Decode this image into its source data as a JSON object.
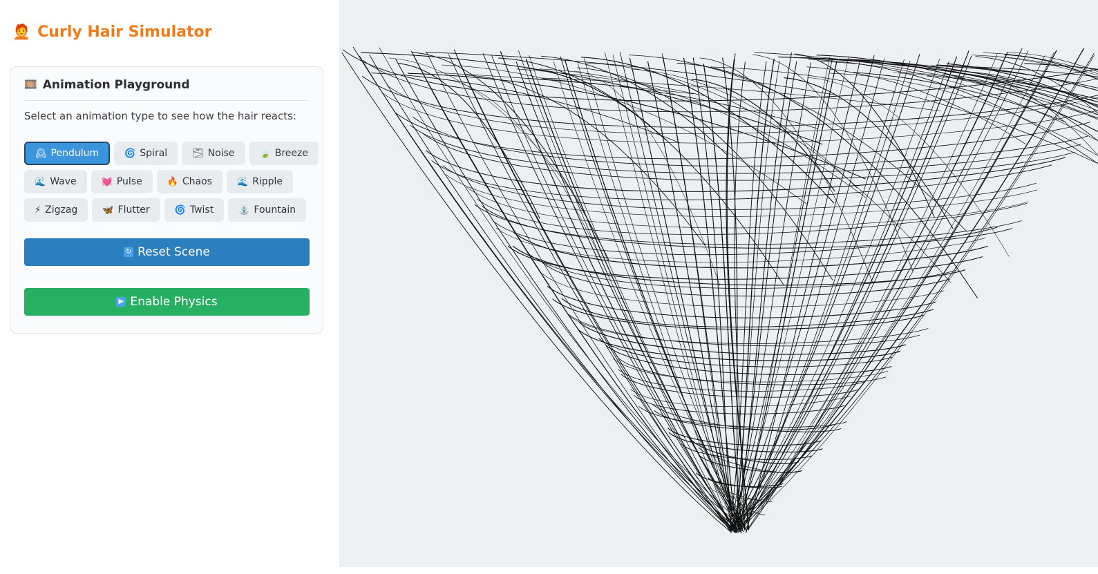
{
  "app": {
    "title": "Curly Hair Simulator",
    "title_icon": "person-red-hair-icon",
    "accent_color": "#f07b1a"
  },
  "panel": {
    "title": "Animation Playground",
    "title_icon": "film-frames-icon",
    "description": "Select an animation type to see how the hair reacts:"
  },
  "animations": [
    {
      "label": "Pendulum",
      "icon": "🕰",
      "icon_name": "mantel-clock-icon",
      "active": true
    },
    {
      "label": "Spiral",
      "icon": "🌀",
      "icon_name": "cyclone-icon",
      "active": false
    },
    {
      "label": "Noise",
      "icon": "🌫",
      "icon_name": "fog-icon",
      "active": false
    },
    {
      "label": "Breeze",
      "icon": "🍃",
      "icon_name": "leaf-icon",
      "active": false
    },
    {
      "label": "Wave",
      "icon": "🌊",
      "icon_name": "wave-icon",
      "active": false
    },
    {
      "label": "Pulse",
      "icon": "💓",
      "icon_name": "beating-heart-icon",
      "active": false
    },
    {
      "label": "Chaos",
      "icon": "🔥",
      "icon_name": "fire-icon",
      "active": false
    },
    {
      "label": "Ripple",
      "icon": "🌊",
      "icon_name": "wave-icon",
      "active": false
    },
    {
      "label": "Zigzag",
      "icon": "⚡",
      "icon_name": "lightning-icon",
      "active": false
    },
    {
      "label": "Flutter",
      "icon": "🦋",
      "icon_name": "butterfly-icon",
      "active": false
    },
    {
      "label": "Twist",
      "icon": "🌀",
      "icon_name": "cyclone-icon",
      "active": false
    },
    {
      "label": "Fountain",
      "icon": "⛲",
      "icon_name": "fountain-icon",
      "active": false
    }
  ],
  "buttons": {
    "reset": {
      "label": "Reset Scene",
      "icon": "🔄",
      "icon_name": "refresh-icon",
      "color": "#2b7fbf"
    },
    "physics": {
      "label": "Enable Physics",
      "icon": "▶",
      "icon_name": "play-icon",
      "color": "#28b062"
    }
  },
  "viewport": {
    "background": "#edf0f1",
    "strand_color": "#111111",
    "content": "3D wireframe hair mesh"
  }
}
